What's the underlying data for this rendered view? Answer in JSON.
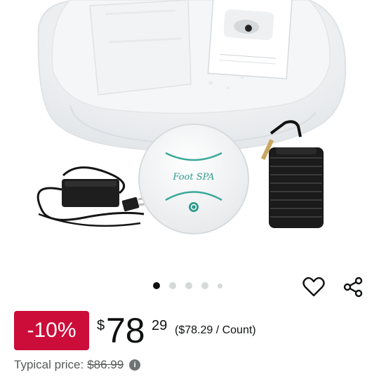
{
  "product_image": {
    "label": "Foot SPA"
  },
  "carousel": {
    "dot_count": 5,
    "active_index": 0
  },
  "actions": {
    "wishlist_icon": "heart-outline-icon",
    "share_icon": "share-icon"
  },
  "pricing": {
    "discount_badge": "-10%",
    "currency_symbol": "$",
    "price_whole": "78",
    "price_fraction": "29",
    "unit_price": "($78.29 / Count)",
    "typical_label": "Typical price:",
    "typical_value": "$86.99",
    "info_icon": "info-icon",
    "badge_color": "#cc0c39"
  }
}
